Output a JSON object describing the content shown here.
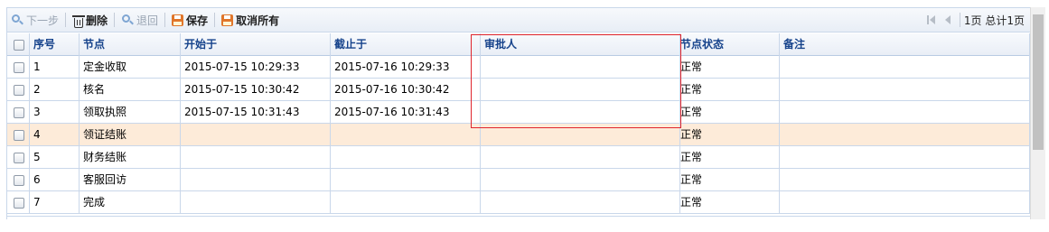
{
  "toolbar": {
    "next_step": "下一步",
    "delete": "删除",
    "back": "退回",
    "save": "保存",
    "cancel_all": "取消所有"
  },
  "pager": {
    "text": "1页 总计1页"
  },
  "columns": {
    "seq": "序号",
    "node": "节点",
    "start": "开始于",
    "deadline": "截止于",
    "approver": "审批人",
    "node_status": "节点状态",
    "remark": "备注"
  },
  "rows": [
    {
      "seq": "1",
      "node": "定金收取",
      "start": "2015-07-15 10:29:33",
      "deadline": "2015-07-16 10:29:33",
      "approver": "",
      "status": "正常",
      "remark": ""
    },
    {
      "seq": "2",
      "node": "核名",
      "start": "2015-07-15 10:30:42",
      "deadline": "2015-07-16 10:30:42",
      "approver": "",
      "status": "正常",
      "remark": ""
    },
    {
      "seq": "3",
      "node": "领取执照",
      "start": "2015-07-15 10:31:43",
      "deadline": "2015-07-16 10:31:43",
      "approver": "",
      "status": "正常",
      "remark": ""
    },
    {
      "seq": "4",
      "node": "领证结账",
      "start": "",
      "deadline": "",
      "approver": "",
      "status": "正常",
      "remark": "",
      "selected": true
    },
    {
      "seq": "5",
      "node": "财务结账",
      "start": "",
      "deadline": "",
      "approver": "",
      "status": "正常",
      "remark": ""
    },
    {
      "seq": "6",
      "node": "客服回访",
      "start": "",
      "deadline": "",
      "approver": "",
      "status": "正常",
      "remark": ""
    },
    {
      "seq": "7",
      "node": "完成",
      "start": "",
      "deadline": "",
      "approver": "",
      "status": "正常",
      "remark": ""
    }
  ],
  "colors": {
    "header_text": "#15428b",
    "selected_row": "#fdebd9",
    "highlight_border": "#e0242c",
    "grid_line": "#c9d7ea"
  }
}
